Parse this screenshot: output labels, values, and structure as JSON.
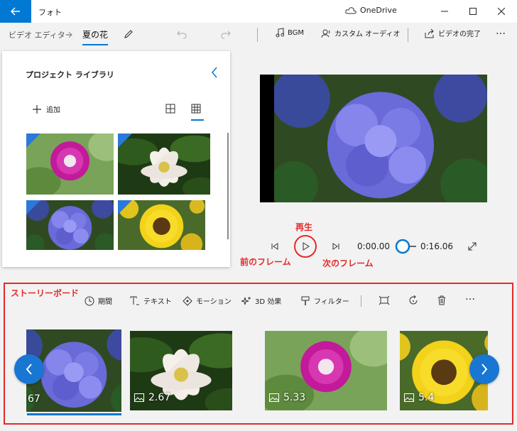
{
  "titlebar": {
    "app_title": "フォト",
    "cloud_label": "OneDrive",
    "back_icon": "arrow-left-icon",
    "minimize_icon": "minimize-icon",
    "maximize_icon": "maximize-icon",
    "close_icon": "close-icon"
  },
  "commandbar": {
    "breadcrumb_parent": "ビデオ エディター",
    "breadcrumb_current": "夏の花",
    "bgm_label": "BGM",
    "custom_audio_label": "カスタム オーディオ",
    "finish_video_label": "ビデオの完了",
    "more_label": "…"
  },
  "library": {
    "title": "プロジェクト ライブラリ",
    "add_label": "追加",
    "items": [
      {
        "subject": "morning-glory"
      },
      {
        "subject": "lotus"
      },
      {
        "subject": "hydrangea"
      },
      {
        "subject": "sunflower"
      }
    ]
  },
  "playback": {
    "current_time": "0:00.00",
    "total_time": "0:16.06",
    "progress": 0.0
  },
  "annotations": {
    "play": "再生",
    "prev_frame": "前のフレーム",
    "next_frame": "次のフレーム"
  },
  "storyboard": {
    "title": "ストーリーボード",
    "tools": {
      "duration": "期間",
      "text": "テキスト",
      "motion": "モーション",
      "effects3d": "3D 効果",
      "filter": "フィルター"
    },
    "clips": [
      {
        "subject": "hydrangea",
        "duration": "67",
        "selected": true
      },
      {
        "subject": "lotus",
        "duration": "2.67",
        "selected": false
      },
      {
        "subject": "morning-glory",
        "duration": "5.33",
        "selected": false
      },
      {
        "subject": "sunflower",
        "duration": "5.4",
        "selected": false
      }
    ]
  },
  "colors": {
    "accent": "#0078d4",
    "annotation": "#e32a2a",
    "nav_button": "#1976d2"
  }
}
